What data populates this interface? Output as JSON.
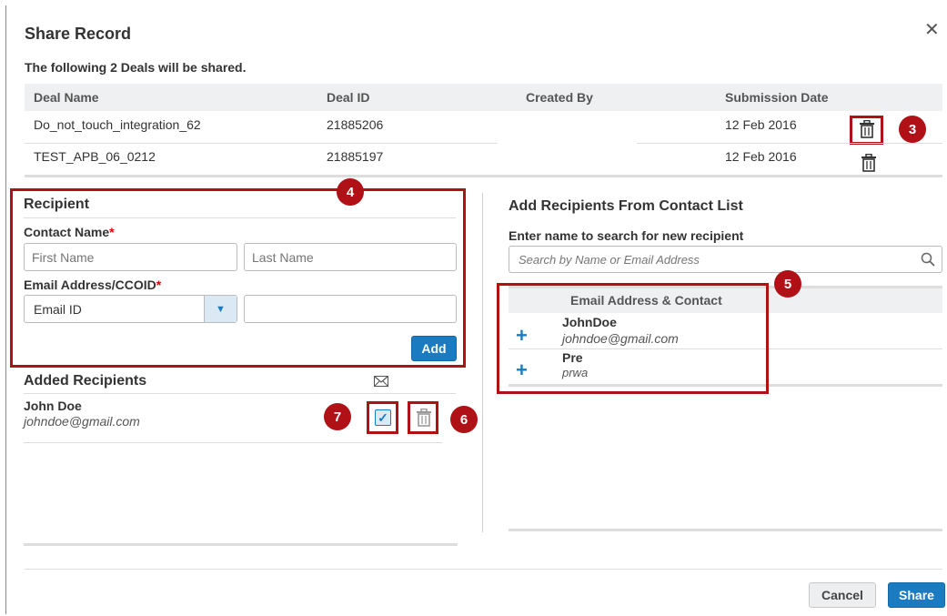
{
  "dialog": {
    "title": "Share Record",
    "close_icon": "close-icon"
  },
  "deals": {
    "heading": "The following 2 Deals will be shared.",
    "columns": [
      "Deal Name",
      "Deal ID",
      "Created By",
      "Submission Date"
    ],
    "rows": [
      {
        "name": "Do_not_touch_integration_62",
        "id": "21885206",
        "created_by": "",
        "date": "12 Feb 2016"
      },
      {
        "name": "TEST_APB_06_0212",
        "id": "21885197",
        "created_by": "",
        "date": "12 Feb 2016"
      }
    ]
  },
  "recipient": {
    "heading": "Recipient",
    "contact_label": "Contact Name",
    "required_mark": "*",
    "first_placeholder": "First Name",
    "last_placeholder": "Last Name",
    "email_label": "Email Address/CCOID",
    "email_type_value": "Email ID",
    "email_value": "",
    "add_button": "Add"
  },
  "added": {
    "heading": "Added Recipients",
    "items": [
      {
        "name": "John Doe",
        "email": "johndoe@gmail.com",
        "checked": true
      }
    ]
  },
  "contacts": {
    "heading": "Add Recipients From Contact List",
    "search_label": "Enter name to search for new recipient",
    "search_placeholder": "Search by Name or Email Address",
    "column": "Email Address & Contact",
    "items": [
      {
        "name": "JohnDoe",
        "email": "johndoe@gmail.com"
      },
      {
        "name": "Pre",
        "email": "prwa"
      }
    ]
  },
  "callouts": [
    "3",
    "4",
    "5",
    "6",
    "7"
  ],
  "footer": {
    "cancel": "Cancel",
    "share": "Share"
  },
  "colors": {
    "accent": "#1b7bc0",
    "callout": "#b01116",
    "required": "#dd0000"
  }
}
